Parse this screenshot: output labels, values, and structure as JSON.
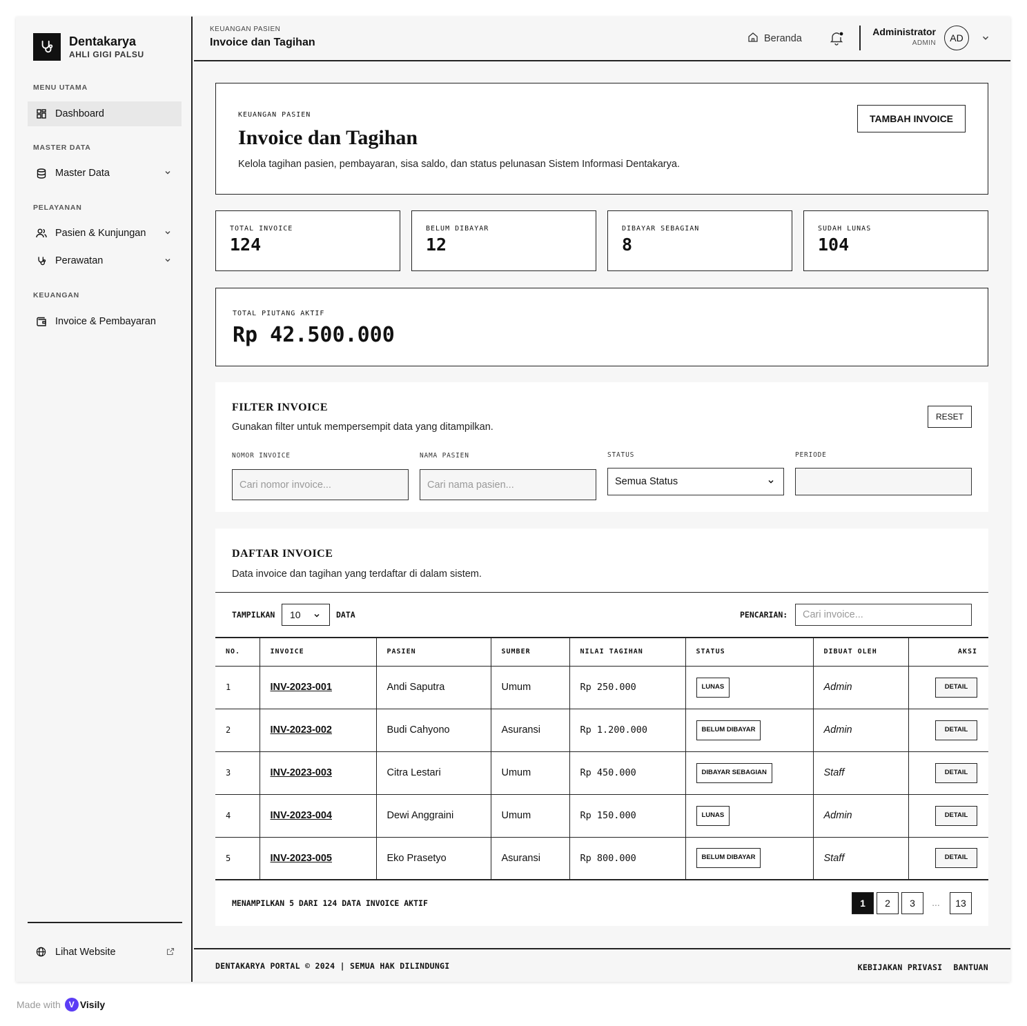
{
  "brand": {
    "name": "Dentakarya",
    "subtitle": "AHLI GIGI PALSU"
  },
  "sidebar": {
    "sections": {
      "main": "MENU UTAMA",
      "master": "MASTER DATA",
      "service": "PELAYANAN",
      "finance": "KEUANGAN"
    },
    "items": [
      {
        "label": "Dashboard",
        "icon": "grid-icon",
        "active": true
      },
      {
        "label": "Master Data",
        "icon": "database-icon"
      },
      {
        "label": "Pasien & Kunjungan",
        "icon": "users-icon"
      },
      {
        "label": "Perawatan",
        "icon": "stethoscope-icon"
      },
      {
        "label": "Invoice & Pembayaran",
        "icon": "wallet-icon"
      }
    ],
    "website_link": "Lihat Website"
  },
  "topbar": {
    "breadcrumb": "KEUANGAN PASIEN",
    "title": "Invoice dan Tagihan",
    "home_label": "Beranda",
    "user_name": "Administrator",
    "user_role": "ADMIN",
    "avatar_initials": "AD"
  },
  "hero": {
    "breadcrumb": "KEUANGAN PASIEN",
    "title": "Invoice dan Tagihan",
    "description": "Kelola tagihan pasien, pembayaran, sisa saldo, dan status pelunasan Sistem Informasi Dentakarya.",
    "add_button": "TAMBAH INVOICE"
  },
  "stats": [
    {
      "label": "TOTAL INVOICE",
      "value": "124"
    },
    {
      "label": "BELUM DIBAYAR",
      "value": "12"
    },
    {
      "label": "DIBAYAR SEBAGIAN",
      "value": "8"
    },
    {
      "label": "SUDAH LUNAS",
      "value": "104"
    }
  ],
  "receivable": {
    "label": "TOTAL PIUTANG AKTIF",
    "value": "Rp 42.500.000"
  },
  "filter": {
    "title": "FILTER INVOICE",
    "description": "Gunakan filter untuk mempersempit data yang ditampilkan.",
    "reset_label": "RESET",
    "invoice_label": "NOMOR INVOICE",
    "invoice_placeholder": "Cari nomor invoice...",
    "patient_label": "NAMA PASIEN",
    "patient_placeholder": "Cari nama pasien...",
    "status_label": "STATUS",
    "status_value": "Semua Status",
    "period_label": "PERIODE",
    "period_value": ""
  },
  "list": {
    "title": "DAFTAR INVOICE",
    "description": "Data invoice dan tagihan yang terdaftar di dalam sistem.",
    "show_label": "TAMPILKAN",
    "page_size": "10",
    "data_label": "DATA",
    "search_label": "PENCARIAN:",
    "search_placeholder": "Cari invoice...",
    "columns": [
      "NO.",
      "INVOICE",
      "PASIEN",
      "SUMBER",
      "NILAI TAGIHAN",
      "STATUS",
      "DIBUAT OLEH",
      "AKSI"
    ],
    "rows": [
      {
        "no": "1",
        "invoice": "INV-2023-001",
        "patient": "Andi Saputra",
        "source": "Umum",
        "amount": "Rp 250.000",
        "status": "LUNAS",
        "creator": "Admin",
        "action": "DETAIL"
      },
      {
        "no": "2",
        "invoice": "INV-2023-002",
        "patient": "Budi Cahyono",
        "source": "Asuransi",
        "amount": "Rp 1.200.000",
        "status": "BELUM DIBAYAR",
        "creator": "Admin",
        "action": "DETAIL"
      },
      {
        "no": "3",
        "invoice": "INV-2023-003",
        "patient": "Citra Lestari",
        "source": "Umum",
        "amount": "Rp 450.000",
        "status": "DIBAYAR SEBAGIAN",
        "creator": "Staff",
        "action": "DETAIL"
      },
      {
        "no": "4",
        "invoice": "INV-2023-004",
        "patient": "Dewi Anggraini",
        "source": "Umum",
        "amount": "Rp 150.000",
        "status": "LUNAS",
        "creator": "Admin",
        "action": "DETAIL"
      },
      {
        "no": "5",
        "invoice": "INV-2023-005",
        "patient": "Eko Prasetyo",
        "source": "Asuransi",
        "amount": "Rp 800.000",
        "status": "BELUM DIBAYAR",
        "creator": "Staff",
        "action": "DETAIL"
      }
    ],
    "summary": "MENAMPILKAN 5 DARI 124 DATA INVOICE AKTIF",
    "pages": [
      "1",
      "2",
      "3",
      "...",
      "13"
    ]
  },
  "footer": {
    "copyright": "DENTAKARYA PORTAL © 2024 | SEMUA HAK DILINDUNGI",
    "privacy": "KEBIJAKAN PRIVASI",
    "help": "BANTUAN"
  },
  "watermark": {
    "prefix": "Made with",
    "name": "Visily"
  }
}
